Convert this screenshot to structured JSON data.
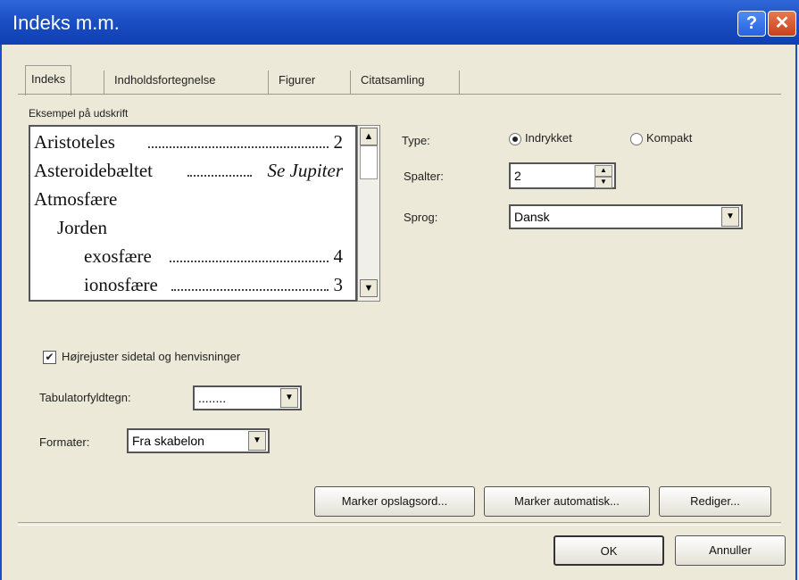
{
  "window": {
    "title": "Indeks m.m.",
    "help_label": "?",
    "close_label": "✕"
  },
  "tabs": [
    {
      "label": "Indeks"
    },
    {
      "label": "Indholdsfortegnelse"
    },
    {
      "label": "Figurer"
    },
    {
      "label": "Citatsamling"
    }
  ],
  "preview": {
    "label": "Eksempel på udskrift",
    "rows": [
      {
        "text": "Aristoteles",
        "page": "2"
      },
      {
        "text": "Asteroidebæltet",
        "page": "Se Jupiter"
      },
      {
        "text": "Atmosfære",
        "page": ""
      },
      {
        "text": "Jorden",
        "page": ""
      },
      {
        "text": "exosfære",
        "page": "4"
      },
      {
        "text": "ionosfære",
        "page": "3"
      }
    ]
  },
  "options": {
    "type_label": "Type:",
    "type_indented": "Indrykket",
    "type_compact": "Kompakt",
    "columns_label": "Spalter:",
    "columns_value": "2",
    "language_label": "Sprog:",
    "language_value": "Dansk"
  },
  "right_align": {
    "label": "Højrejuster sidetal og henvisninger",
    "checked": true
  },
  "tab_leader": {
    "label": "Tabulatorfyldtegn:",
    "value": "........"
  },
  "formats": {
    "label": "Formater:",
    "value": "Fra skabelon"
  },
  "buttons": {
    "mark_entry": "Marker opslagsord...",
    "automark": "Marker automatisk...",
    "modify": "Rediger...",
    "ok": "OK",
    "cancel": "Annuller"
  },
  "colors": {
    "title_bar": "#1c4fc4",
    "dialog_bg": "#ece9d8",
    "close_button": "#c8401c"
  }
}
